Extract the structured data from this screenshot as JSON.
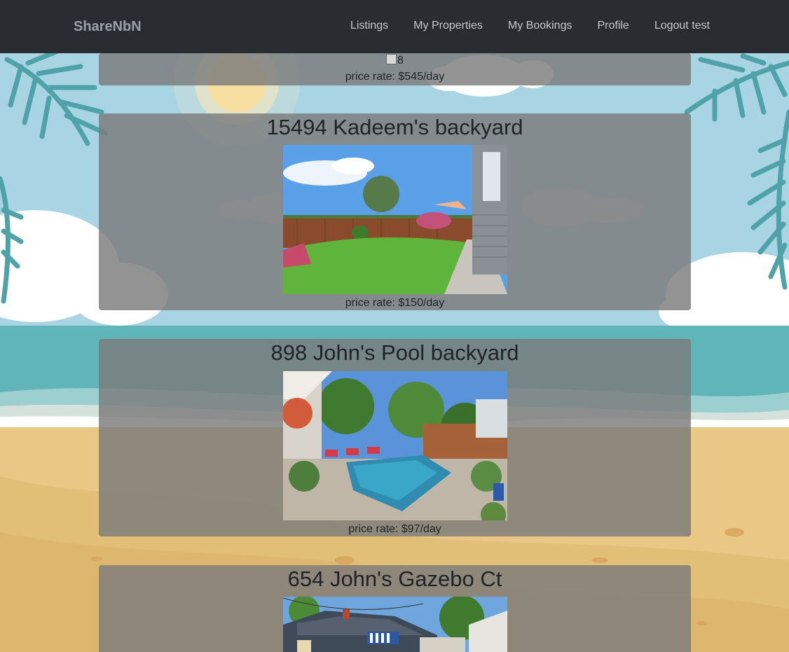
{
  "navbar": {
    "brand": "ShareNbN",
    "links": [
      "Listings",
      "My Properties",
      "My Bookings",
      "Profile",
      "Logout test"
    ]
  },
  "listings": [
    {
      "title": "",
      "image_alt": "8",
      "price": "price rate: $545/day"
    },
    {
      "title": "15494 Kadeem's backyard",
      "price": "price rate: $150/day"
    },
    {
      "title": "898 John's Pool backyard",
      "price": "price rate: $97/day"
    },
    {
      "title": "654 John's Gazebo Ct",
      "price": ""
    }
  ],
  "colors": {
    "navbar": "#292d31",
    "card_overlay": "#7b7b7b",
    "sky": "#a9d4e4",
    "sea": "#5fb5b7",
    "sand": "#e8c884"
  },
  "icons": [
    "palm-leaf-icon",
    "sun-icon",
    "cloud-icon",
    "broken-image-icon"
  ]
}
